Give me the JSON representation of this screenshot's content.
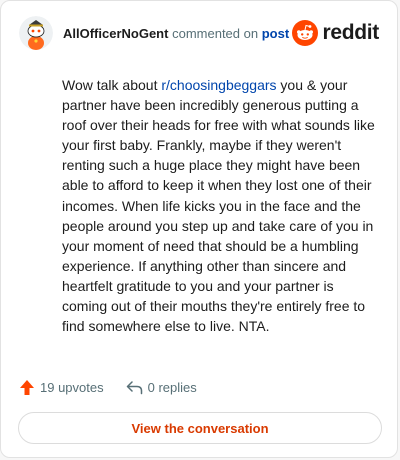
{
  "comment": {
    "username": "AllOfficerNoGent",
    "action_text": "commented on",
    "post_link_label": "post",
    "body_before_link": "Wow talk about ",
    "subreddit_link": "r/choosingbeggars",
    "body_after_link": " you & your partner have been incredibly generous putting a roof over their heads for free with what sounds like your first baby. Frankly, maybe if they weren't renting such a huge place they might have been able to afford to keep it when they lost one of their incomes. When life kicks you in the face and the people around you step up and take care of you in your moment of need that should be a humbling experience. If anything other than sincere and heartfelt gratitude to you and your partner is coming out of their mouths they're entirely free to find somewhere else to live. NTA."
  },
  "brand": {
    "wordmark": "reddit",
    "color": "#ff4500"
  },
  "actions": {
    "upvotes_label": "19 upvotes",
    "replies_label": "0 replies",
    "upvote_icon": "upvote-arrow-icon",
    "reply_icon": "reply-arrow-icon"
  },
  "cta": {
    "label": "View the conversation",
    "color": "#d93a00"
  }
}
